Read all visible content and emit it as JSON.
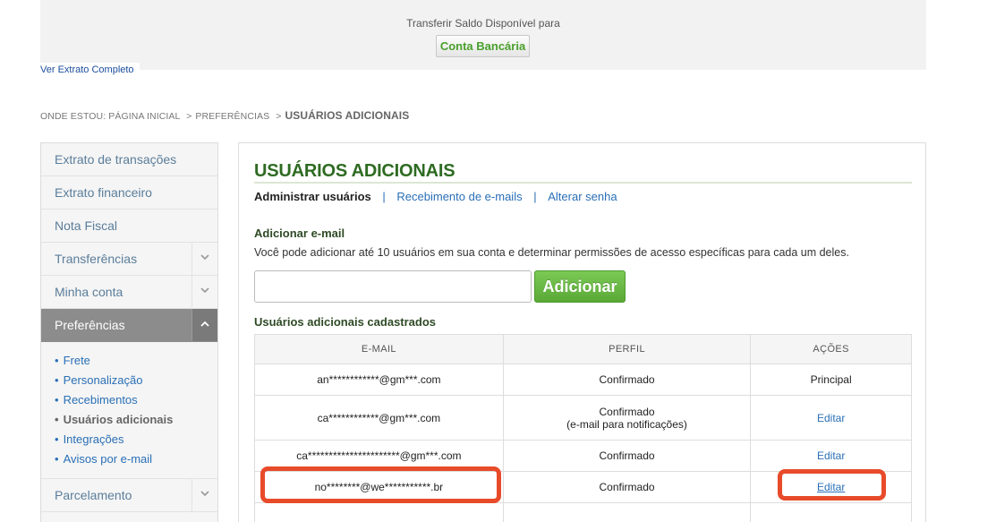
{
  "top_panel": {
    "transfer_label": "Transferir Saldo Disponível para",
    "bank_button": "Conta Bancária",
    "extrato_link": "Ver Extrato Completo"
  },
  "breadcrumb": {
    "prefix": "ONDE ESTOU:",
    "items": [
      "PÁGINA INICIAL",
      "PREFERÊNCIAS"
    ],
    "separator": ">",
    "current": "USUÁRIOS ADICIONAIS"
  },
  "sidebar": {
    "items": [
      {
        "label": "Extrato de transações"
      },
      {
        "label": "Extrato financeiro"
      },
      {
        "label": "Nota Fiscal"
      },
      {
        "label": "Transferências",
        "expand_icon": "chevron-down-icon"
      },
      {
        "label": "Minha conta",
        "expand_icon": "chevron-down-icon"
      },
      {
        "label": "Preferências",
        "expand_icon": "chevron-up-icon"
      }
    ],
    "submenu": [
      "Frete",
      "Personalização",
      "Recebimentos",
      "Usuários adicionais",
      "Integrações",
      "Avisos por e-mail"
    ],
    "submenu_current": "Usuários adicionais",
    "after_items": [
      {
        "label": "Parcelamento",
        "expand_icon": "chevron-down-icon"
      }
    ]
  },
  "main": {
    "title": "USUÁRIOS ADICIONAIS",
    "tabs": {
      "active": "Administrar usuários",
      "links": [
        "Recebimento de e-mails",
        "Alterar senha"
      ],
      "separator": "|"
    },
    "add_section_title": "Adicionar e-mail",
    "add_description": "Você pode adicionar até 10 usuários em sua conta e determinar permissões de acesso específicas para cada um deles.",
    "email_input": {
      "value": "",
      "placeholder": ""
    },
    "add_button": "Adicionar",
    "registered_title": "Usuários adicionais cadastrados",
    "table": {
      "headers": {
        "email": "E-MAIL",
        "perfil": "PERFIL",
        "acoes": "AÇÕES"
      },
      "rows": [
        {
          "email": "an************@gm***.com",
          "perfil": "Confirmado",
          "perfil_sub": "",
          "acao": "Principal"
        },
        {
          "email": "ca************@gm***.com",
          "perfil": "Confirmado",
          "perfil_sub": "(e-mail para notificações)",
          "acao": "Editar"
        },
        {
          "email": "ca**********************@gm***.com",
          "perfil": "Confirmado",
          "perfil_sub": "",
          "acao": "Editar"
        },
        {
          "email": "no********@we***********.br",
          "perfil": "Confirmado",
          "perfil_sub": "",
          "acao": "Editar"
        }
      ]
    }
  },
  "colors": {
    "title_green": "#2e6b22",
    "link_blue": "#2a6fb6",
    "add_button_green": "#5aa937",
    "highlight_red": "#e84b2a",
    "sidebar_active": "#8c8c8c"
  }
}
